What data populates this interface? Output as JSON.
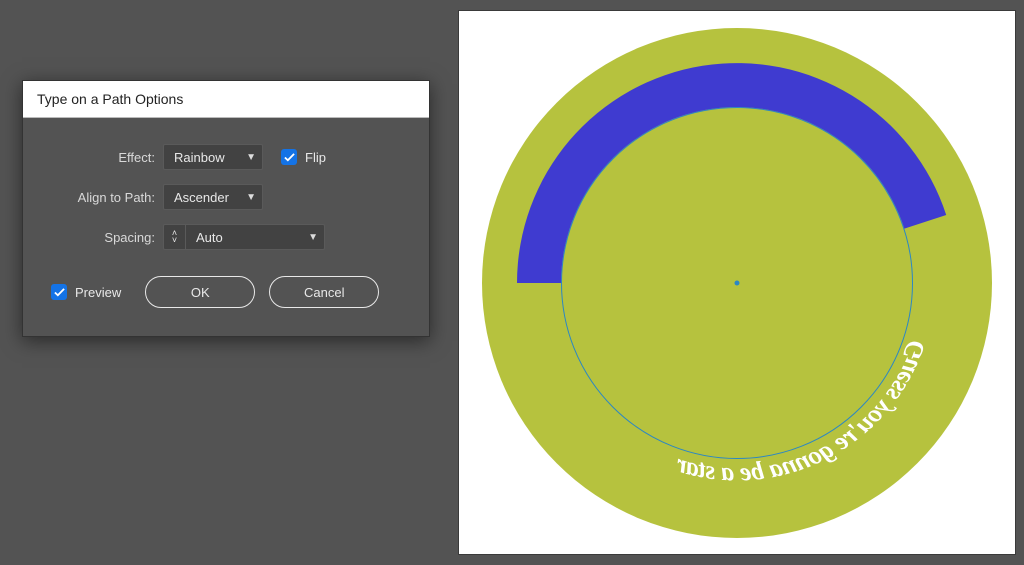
{
  "dialog": {
    "title": "Type on a Path Options",
    "effect": {
      "label": "Effect:",
      "value": "Rainbow"
    },
    "flip": {
      "label": "Flip",
      "checked": true
    },
    "align": {
      "label": "Align to Path:",
      "value": "Ascender"
    },
    "spacing": {
      "label": "Spacing:",
      "value": "Auto"
    },
    "preview": {
      "label": "Preview",
      "checked": true
    },
    "ok": "OK",
    "cancel": "Cancel"
  },
  "artwork": {
    "circle_fill": "#b6c23e",
    "band_fill": "#3f3bd0",
    "text_color": "#ffffff",
    "path_text": "Guess you're gonna be a star"
  }
}
